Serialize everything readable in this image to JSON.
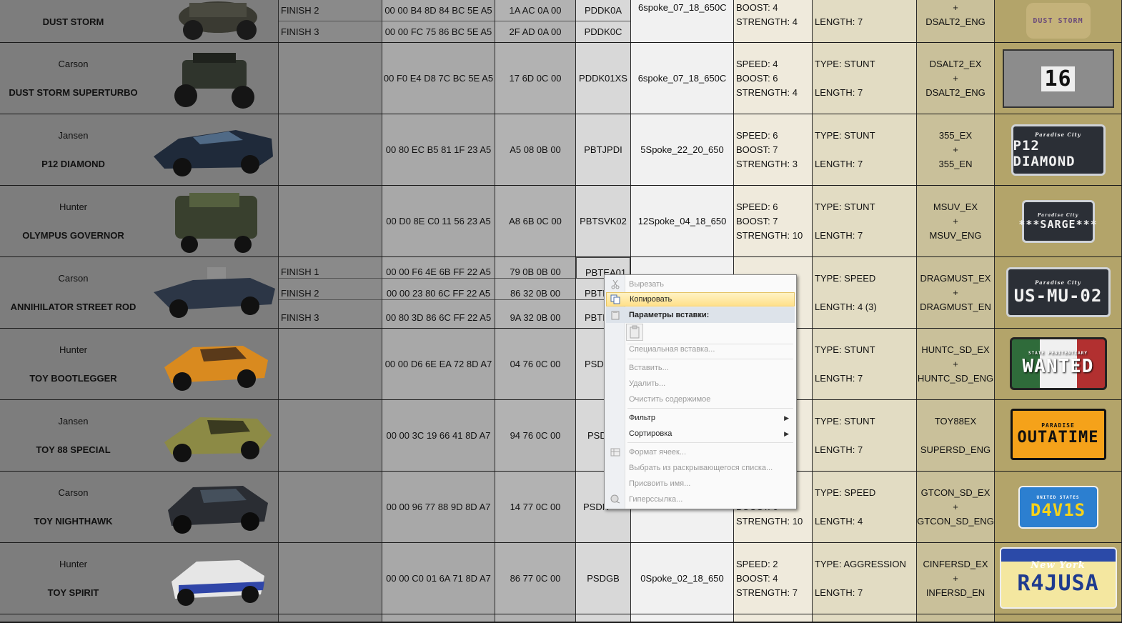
{
  "rows": [
    {
      "owner": "",
      "name": "DUST STORM",
      "finish": [
        "",
        "FINISH 2",
        "FINISH 3"
      ],
      "hex": [
        "",
        "00 00 B4 8D 84 BC 5E A5",
        "00 00 FC 75 86 BC 5E A5"
      ],
      "ids": [
        "",
        "1A AC 0A 00",
        "2F AD 0A 00"
      ],
      "codes": [
        "",
        "PDDK0A",
        "PDDK0C"
      ],
      "wheel": "6spoke_07_18_650C",
      "stats": [
        "BOOST: 4",
        "STRENGTH: 4"
      ],
      "type": "",
      "length": "LENGTH: 7",
      "eng": [
        "+",
        "DSALT2_ENG"
      ],
      "plate": ""
    },
    {
      "owner": "Carson",
      "name": "DUST STORM SUPERTURBO",
      "hex": "00 F0 E4 D8 7C BC 5E A5",
      "id": "17 6D 0C 00",
      "code": "PDDK01XS",
      "wheel": "6spoke_07_18_650C",
      "stats": [
        "SPEED: 4",
        "BOOST: 6",
        "STRENGTH: 4"
      ],
      "type": "TYPE: STUNT",
      "length": "LENGTH: 7",
      "eng": [
        "DSALT2_EX",
        "+",
        "DSALT2_ENG"
      ],
      "plate": "16"
    },
    {
      "owner": "Jansen",
      "name": "P12 DIAMOND",
      "hex": "00 80 EC B5 81 1F 23 A5",
      "id": "A5 08 0B 00",
      "code": "PBTJPDI",
      "wheel": "5Spoke_22_20_650",
      "stats": [
        "SPEED: 6",
        "BOOST: 7",
        "STRENGTH: 3"
      ],
      "type": "TYPE: STUNT",
      "length": "LENGTH: 7",
      "eng": [
        "355_EX",
        "+",
        "355_EN"
      ],
      "plate": "P12 DIAMOND"
    },
    {
      "owner": "Hunter",
      "name": "OLYMPUS GOVERNOR",
      "hex": "00 D0 8E C0 11 56 23 A5",
      "id": "A8 6B 0C 00",
      "code": "PBTSVK02",
      "wheel": "12Spoke_04_18_650",
      "stats": [
        "SPEED: 6",
        "BOOST: 7",
        "STRENGTH: 10"
      ],
      "type": "TYPE: STUNT",
      "length": "LENGTH: 7",
      "eng": [
        "MSUV_EX",
        "+",
        "MSUV_ENG"
      ],
      "plate": "***SARGE***"
    },
    {
      "owner": "Carson",
      "name": "ANNIHILATOR STREET ROD",
      "finish": [
        "FINISH 1",
        "FINISH 2",
        "FINISH 3"
      ],
      "hex": [
        "00 00 F6 4E 6B FF 22 A5",
        "00 00 23 80 6C FF 22 A5",
        "00 80 3D 86 6C FF 22 A5"
      ],
      "ids": [
        "79 0B 0B 00",
        "86 32 0B 00",
        "9A 32 0B 00"
      ],
      "codes": [
        "PBTEA01",
        "PBTE",
        "PBTE"
      ],
      "wheel": "",
      "stats": [],
      "type": "TYPE: SPEED",
      "length": "LENGTH: 4 (3)",
      "eng": [
        "DRAGMUST_EX",
        "+",
        "DRAGMUST_EN"
      ],
      "plate": "US-MU-02"
    },
    {
      "owner": "Hunter",
      "name": "TOY BOOTLEGGER",
      "hex": "00 00 D6 6E EA 72 8D A7",
      "id": "04 76 0C 00",
      "code": "PSD(",
      "wheel": "",
      "stats": [],
      "type": "TYPE: STUNT",
      "length": "LENGTH: 7",
      "eng": [
        "HUNTC_SD_EX",
        "+",
        "HUNTC_SD_ENG"
      ],
      "plate": "WANTED"
    },
    {
      "owner": "Jansen",
      "name": "TOY 88 SPECIAL",
      "hex": "00 00 3C 19 66 41 8D A7",
      "id": "94 76 0C 00",
      "code": "PSD",
      "wheel": "",
      "stats": [],
      "type": "TYPE: STUNT",
      "length": "LENGTH: 7",
      "eng": [
        "TOY88EX",
        "",
        "SUPERSD_ENG"
      ],
      "plate": "OUTATIME"
    },
    {
      "owner": "Carson",
      "name": "TOY NIGHTHAWK",
      "hex": "00 00 96 77 88 9D 8D A7",
      "id": "14 77 0C 00",
      "code": "PSDN",
      "wheel": "",
      "stats": [
        "",
        "BOOST: 6",
        "STRENGTH: 10"
      ],
      "type": "TYPE: SPEED",
      "length": "LENGTH: 4",
      "eng": [
        "GTCON_SD_EX",
        "+",
        "GTCON_SD_ENG"
      ],
      "plate": "D4V1S"
    },
    {
      "owner": "Hunter",
      "name": "TOY SPIRIT",
      "hex": "00 00 C0 01 6A 71 8D A7",
      "id": "86 77 0C 00",
      "code": "PSDGB",
      "wheel": "0Spoke_02_18_650",
      "stats": [
        "SPEED: 2",
        "BOOST: 4",
        "STRENGTH: 7"
      ],
      "type": "TYPE: AGGRESSION",
      "length": "LENGTH: 7",
      "eng": [
        "CINFERSD_EX",
        "+",
        "INFERSD_EN"
      ],
      "plate": "R4JUSA",
      "plate_top": "New York"
    }
  ],
  "plate_small": [
    "Paradise City",
    "Paradise City",
    "Paradise City",
    "Paradise City",
    "STATE PENITENTIARY",
    "PARADISE",
    "UNITED STATES"
  ],
  "context_menu": {
    "cut": "Вырезать",
    "copy": "Копировать",
    "paste_options": "Параметры вставки:",
    "paste_special": "Специальная вставка...",
    "insert": "Вставить...",
    "delete": "Удалить...",
    "clear": "Очистить содержимое",
    "filter": "Фильтр",
    "sort": "Сортировка",
    "format_cells": "Формат ячеек...",
    "pick_list": "Выбрать из раскрывающегося списка...",
    "name": "Присвоить имя...",
    "hyperlink": "Гиперссылка..."
  },
  "colors": {
    "menu_highlight": "#ffe08a",
    "sheet_bg": "#6f6f6f"
  }
}
